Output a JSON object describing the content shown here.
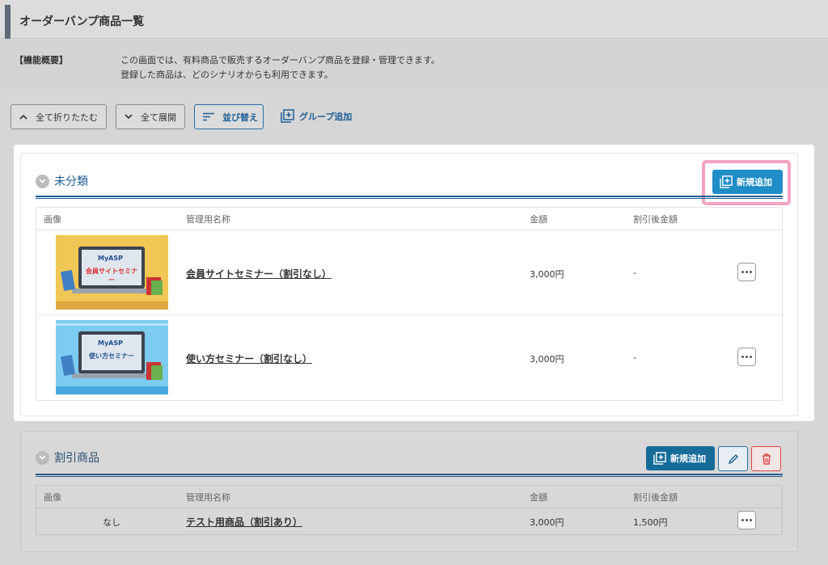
{
  "header": {
    "title": "オーダーバンプ商品一覧"
  },
  "overview": {
    "label": "【機能概要】",
    "line1": "この画面では、有料商品で販売するオーダーバンプ商品を登録・管理できます。",
    "line2": "登録した商品は、どのシナリオからも利用できます。"
  },
  "toolbar": {
    "collapse_all": "全て折りたたむ",
    "expand_all": "全て展開",
    "sort": "並び替え",
    "add_group": "グループ追加"
  },
  "columns": {
    "image": "画像",
    "name": "管理用名称",
    "price": "金額",
    "discount_price": "割引後金額"
  },
  "groups": [
    {
      "title": "未分類",
      "add_button": "新規追加",
      "rows": [
        {
          "image_brand": "MyASP",
          "image_caption": "会員サイトセミナー",
          "name": "会員サイトセミナー（割引なし）",
          "price": "3,000円",
          "discount_price": "-"
        },
        {
          "image_brand": "MyASP",
          "image_caption": "使い方セミナー",
          "name": "使い方セミナー（割引なし）",
          "price": "3,000円",
          "discount_price": "-"
        }
      ]
    },
    {
      "title": "割引商品",
      "add_button": "新規追加",
      "rows": [
        {
          "image_text": "なし",
          "name": "テスト用商品（割引あり）",
          "price": "3,000円",
          "discount_price": "1,500円"
        }
      ]
    }
  ],
  "colors": {
    "accent": "#1f8dc6",
    "highlight": "#f5a3c2",
    "danger": "#dd4444"
  }
}
